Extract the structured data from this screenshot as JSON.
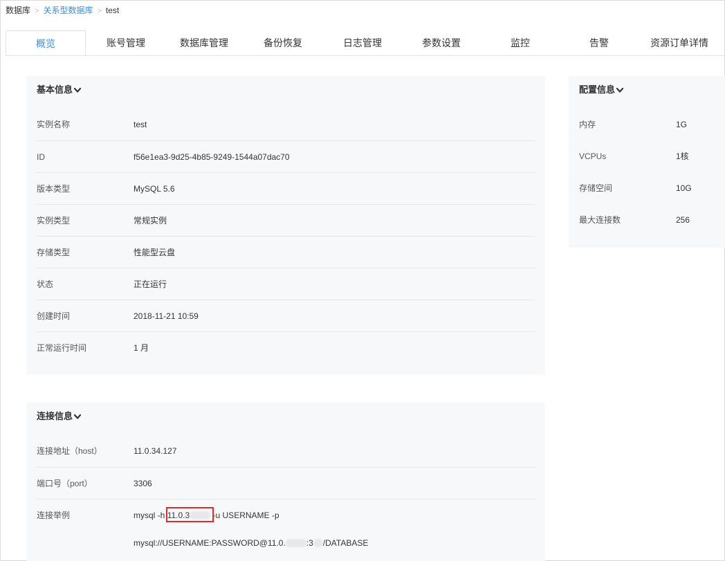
{
  "breadcrumb": {
    "root": "数据库",
    "section": "关系型数据库",
    "current": "test"
  },
  "tabs": [
    "概览",
    "账号管理",
    "数据库管理",
    "备份恢复",
    "日志管理",
    "参数设置",
    "监控",
    "告警",
    "资源订单详情"
  ],
  "basic": {
    "title": "基本信息",
    "rows": [
      {
        "label": "实例名称",
        "value": "test"
      },
      {
        "label": "ID",
        "value": "f56e1ea3-9d25-4b85-9249-1544a07dac70"
      },
      {
        "label": "版本类型",
        "value": "MySQL 5.6"
      },
      {
        "label": "实例类型",
        "value": "常规实例"
      },
      {
        "label": "存储类型",
        "value": "性能型云盘"
      },
      {
        "label": "状态",
        "value": "正在运行"
      },
      {
        "label": "创建时间",
        "value": "2018-11-21 10:59"
      },
      {
        "label": "正常运行时间",
        "value": "1 月"
      }
    ]
  },
  "config": {
    "title": "配置信息",
    "rows": [
      {
        "label": "内存",
        "value": "1G"
      },
      {
        "label": "VCPUs",
        "value": "1核"
      },
      {
        "label": "存储空间",
        "value": "10G"
      },
      {
        "label": "最大连接数",
        "value": "256"
      }
    ]
  },
  "connect": {
    "title": "连接信息",
    "host_label": "连接地址（host）",
    "host_value": "11.0.34.127",
    "port_label": "端口号（port）",
    "port_value": "3306",
    "example_label": "连接举例",
    "cmd_prefix": "mysql -h",
    "cmd_host_visible": "11.0.3",
    "cmd_suffix": "-u USERNAME -p",
    "url_prefix": "mysql://USERNAME:PASSWORD@11.0.",
    "url_mid": ":3",
    "url_suffix": "/DATABASE"
  },
  "colors": {
    "accent": "#3b8fe0",
    "highlight": "#e02b2b",
    "panel_bg": "#f7f8fa"
  }
}
